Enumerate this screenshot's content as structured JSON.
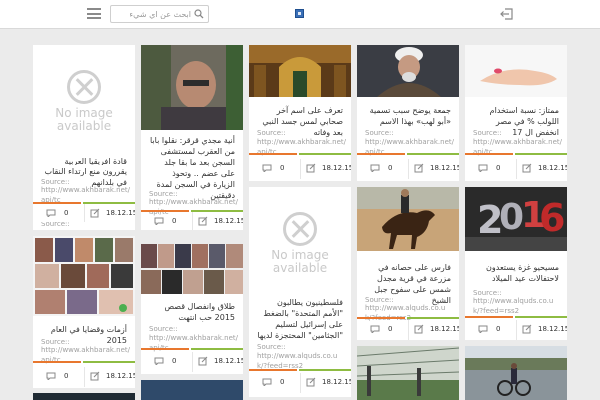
{
  "header": {
    "search_placeholder": "ابحث عن اي شيء"
  },
  "common": {
    "no_image": "No image available",
    "source_label": "Source::",
    "comments": "0",
    "date": "18.12.15"
  },
  "cards": [
    {
      "title": "قادة افريقيا العربية يقررون منع ارتداء النقاب في بلدانهم",
      "url": "http://www.akhbarak.net/api/tc"
    },
    {
      "title": "أنية مجدي قرقر: نقلوا بابا من العقرب لمستشفى السجن بعد ما بقا جلد على عضم .. وتحوذ الزيارة في السجن لمدة دقيقتين",
      "url": "http://www.akhbarak.net/api/tc"
    },
    {
      "title": "تعرف على اسم آخر صحابي لمس جسد النبي بعد وفاته",
      "url": "http://www.akhbarak.net/api/tc"
    },
    {
      "title": "جمعة يوضح سبب تسمية «أبو لهب» بهذا الاسم",
      "url": "http://www.akhbarak.net/api/tc"
    },
    {
      "title": "ممتاز: نسبة استخدام اللولب % في مصر انخفض ال 17",
      "url": "http://www.akhbarak.net/api/tc"
    },
    {
      "title": "أزمات وقضايا في العام 2015",
      "url": "http://www.akhbarak.net/api/tc"
    },
    {
      "title": "طلاق وانفصال قصص 2015 حب انتهت",
      "url": "http://www.akhbarak.net/api/tc"
    },
    {
      "title": "فلسطينيون يطالبون \"الأمم المتحدة\" بالضغط على إسرائيل لتسليم \"الجثامين\" المحتجزة لديها",
      "url": "http://www.alquds.co.uk/?feed=rss2"
    },
    {
      "title": "فارس على حصانه في مزرعة في قرية مجدل شمس على سفوح جبل الشيخ",
      "url": "http://www.alquds.co.uk/?feed=rss2"
    },
    {
      "title": "مسيحيو غزة يستعدون لاحتفالات عيد الميلاد",
      "url": "http://www.alquds.co.uk/?feed=rss2"
    }
  ],
  "colors": {
    "bar_orange": "#e8772e",
    "bar_green": "#8ebc42",
    "background": "#ebebeb",
    "logo": "#3a6fb7"
  }
}
